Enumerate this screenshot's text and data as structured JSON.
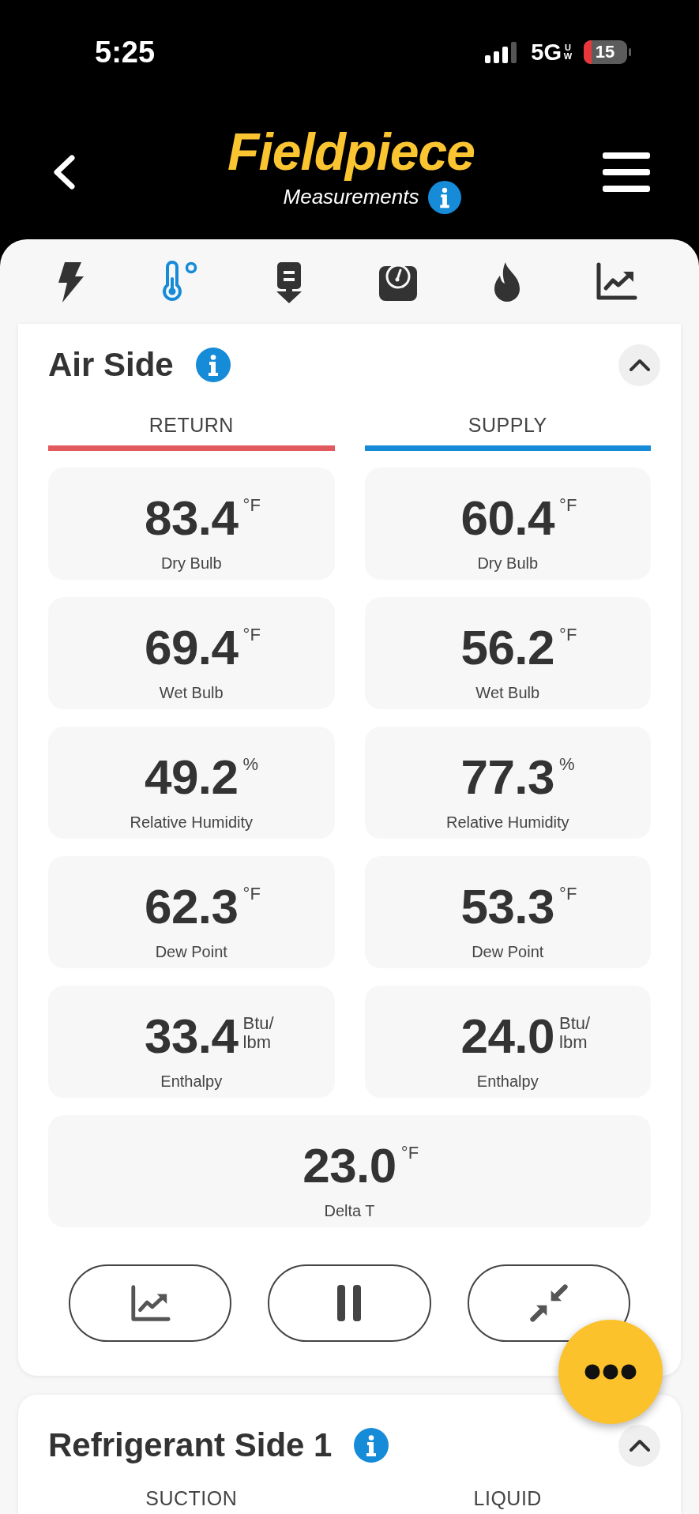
{
  "status_bar": {
    "time": "5:25",
    "network": "5G",
    "network_band": "UW",
    "battery": "15"
  },
  "header": {
    "logo": "Fieldpiece",
    "subtitle": "Measurements"
  },
  "tabs": [
    {
      "selected": false
    },
    {
      "selected": true
    },
    {
      "selected": false
    },
    {
      "selected": false
    },
    {
      "selected": false
    },
    {
      "selected": false
    }
  ],
  "sections": [
    {
      "title": "Air Side",
      "expanded": true,
      "columns": [
        {
          "label": "RETURN",
          "color": "#e05a5e"
        },
        {
          "label": "SUPPLY",
          "color": "#168bd8"
        }
      ],
      "rows": [
        [
          {
            "value": "83.4",
            "unit": "°F",
            "label": "Dry Bulb"
          },
          {
            "value": "60.4",
            "unit": "°F",
            "label": "Dry Bulb"
          }
        ],
        [
          {
            "value": "69.4",
            "unit": "°F",
            "label": "Wet Bulb"
          },
          {
            "value": "56.2",
            "unit": "°F",
            "label": "Wet Bulb"
          }
        ],
        [
          {
            "value": "49.2",
            "unit": "%",
            "label": "Relative Humidity"
          },
          {
            "value": "77.3",
            "unit": "%",
            "label": "Relative Humidity"
          }
        ],
        [
          {
            "value": "62.3",
            "unit": "°F",
            "label": "Dew Point"
          },
          {
            "value": "53.3",
            "unit": "°F",
            "label": "Dew Point"
          }
        ],
        [
          {
            "value": "33.4",
            "unit": "Btu/lbm",
            "label": "Enthalpy"
          },
          {
            "value": "24.0",
            "unit": "Btu/lbm",
            "label": "Enthalpy"
          }
        ]
      ],
      "summary": {
        "value": "23.0",
        "unit": "°F",
        "label": "Delta T"
      }
    },
    {
      "title": "Refrigerant Side 1",
      "expanded": true,
      "columns": [
        {
          "label": "SUCTION"
        },
        {
          "label": "LIQUID"
        }
      ]
    }
  ]
}
